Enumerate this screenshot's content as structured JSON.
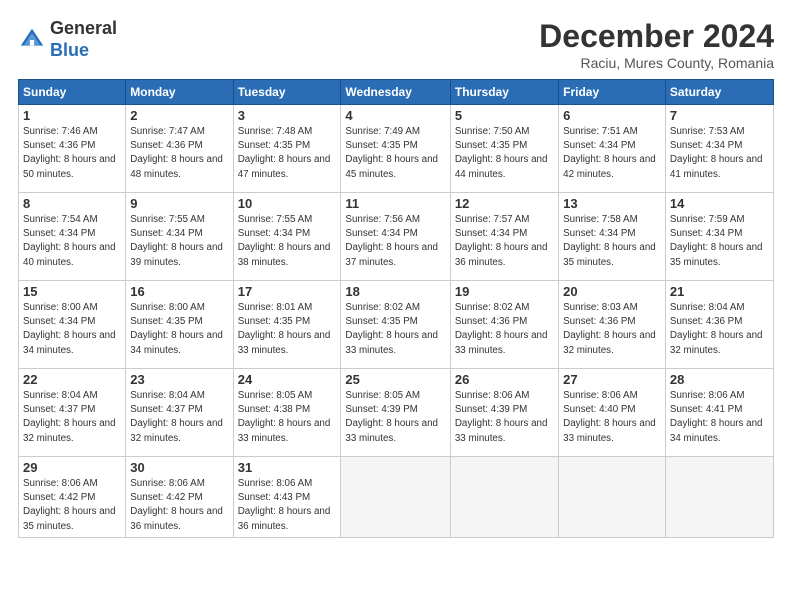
{
  "logo": {
    "line1": "General",
    "line2": "Blue"
  },
  "header": {
    "title": "December 2024",
    "location": "Raciu, Mures County, Romania"
  },
  "weekdays": [
    "Sunday",
    "Monday",
    "Tuesday",
    "Wednesday",
    "Thursday",
    "Friday",
    "Saturday"
  ],
  "weeks": [
    [
      {
        "day": "1",
        "sunrise": "7:46 AM",
        "sunset": "4:36 PM",
        "daylight": "8 hours and 50 minutes."
      },
      {
        "day": "2",
        "sunrise": "7:47 AM",
        "sunset": "4:36 PM",
        "daylight": "8 hours and 48 minutes."
      },
      {
        "day": "3",
        "sunrise": "7:48 AM",
        "sunset": "4:35 PM",
        "daylight": "8 hours and 47 minutes."
      },
      {
        "day": "4",
        "sunrise": "7:49 AM",
        "sunset": "4:35 PM",
        "daylight": "8 hours and 45 minutes."
      },
      {
        "day": "5",
        "sunrise": "7:50 AM",
        "sunset": "4:35 PM",
        "daylight": "8 hours and 44 minutes."
      },
      {
        "day": "6",
        "sunrise": "7:51 AM",
        "sunset": "4:34 PM",
        "daylight": "8 hours and 42 minutes."
      },
      {
        "day": "7",
        "sunrise": "7:53 AM",
        "sunset": "4:34 PM",
        "daylight": "8 hours and 41 minutes."
      }
    ],
    [
      {
        "day": "8",
        "sunrise": "7:54 AM",
        "sunset": "4:34 PM",
        "daylight": "8 hours and 40 minutes."
      },
      {
        "day": "9",
        "sunrise": "7:55 AM",
        "sunset": "4:34 PM",
        "daylight": "8 hours and 39 minutes."
      },
      {
        "day": "10",
        "sunrise": "7:55 AM",
        "sunset": "4:34 PM",
        "daylight": "8 hours and 38 minutes."
      },
      {
        "day": "11",
        "sunrise": "7:56 AM",
        "sunset": "4:34 PM",
        "daylight": "8 hours and 37 minutes."
      },
      {
        "day": "12",
        "sunrise": "7:57 AM",
        "sunset": "4:34 PM",
        "daylight": "8 hours and 36 minutes."
      },
      {
        "day": "13",
        "sunrise": "7:58 AM",
        "sunset": "4:34 PM",
        "daylight": "8 hours and 35 minutes."
      },
      {
        "day": "14",
        "sunrise": "7:59 AM",
        "sunset": "4:34 PM",
        "daylight": "8 hours and 35 minutes."
      }
    ],
    [
      {
        "day": "15",
        "sunrise": "8:00 AM",
        "sunset": "4:34 PM",
        "daylight": "8 hours and 34 minutes."
      },
      {
        "day": "16",
        "sunrise": "8:00 AM",
        "sunset": "4:35 PM",
        "daylight": "8 hours and 34 minutes."
      },
      {
        "day": "17",
        "sunrise": "8:01 AM",
        "sunset": "4:35 PM",
        "daylight": "8 hours and 33 minutes."
      },
      {
        "day": "18",
        "sunrise": "8:02 AM",
        "sunset": "4:35 PM",
        "daylight": "8 hours and 33 minutes."
      },
      {
        "day": "19",
        "sunrise": "8:02 AM",
        "sunset": "4:36 PM",
        "daylight": "8 hours and 33 minutes."
      },
      {
        "day": "20",
        "sunrise": "8:03 AM",
        "sunset": "4:36 PM",
        "daylight": "8 hours and 32 minutes."
      },
      {
        "day": "21",
        "sunrise": "8:04 AM",
        "sunset": "4:36 PM",
        "daylight": "8 hours and 32 minutes."
      }
    ],
    [
      {
        "day": "22",
        "sunrise": "8:04 AM",
        "sunset": "4:37 PM",
        "daylight": "8 hours and 32 minutes."
      },
      {
        "day": "23",
        "sunrise": "8:04 AM",
        "sunset": "4:37 PM",
        "daylight": "8 hours and 32 minutes."
      },
      {
        "day": "24",
        "sunrise": "8:05 AM",
        "sunset": "4:38 PM",
        "daylight": "8 hours and 33 minutes."
      },
      {
        "day": "25",
        "sunrise": "8:05 AM",
        "sunset": "4:39 PM",
        "daylight": "8 hours and 33 minutes."
      },
      {
        "day": "26",
        "sunrise": "8:06 AM",
        "sunset": "4:39 PM",
        "daylight": "8 hours and 33 minutes."
      },
      {
        "day": "27",
        "sunrise": "8:06 AM",
        "sunset": "4:40 PM",
        "daylight": "8 hours and 33 minutes."
      },
      {
        "day": "28",
        "sunrise": "8:06 AM",
        "sunset": "4:41 PM",
        "daylight": "8 hours and 34 minutes."
      }
    ],
    [
      {
        "day": "29",
        "sunrise": "8:06 AM",
        "sunset": "4:42 PM",
        "daylight": "8 hours and 35 minutes."
      },
      {
        "day": "30",
        "sunrise": "8:06 AM",
        "sunset": "4:42 PM",
        "daylight": "8 hours and 36 minutes."
      },
      {
        "day": "31",
        "sunrise": "8:06 AM",
        "sunset": "4:43 PM",
        "daylight": "8 hours and 36 minutes."
      },
      null,
      null,
      null,
      null
    ]
  ]
}
